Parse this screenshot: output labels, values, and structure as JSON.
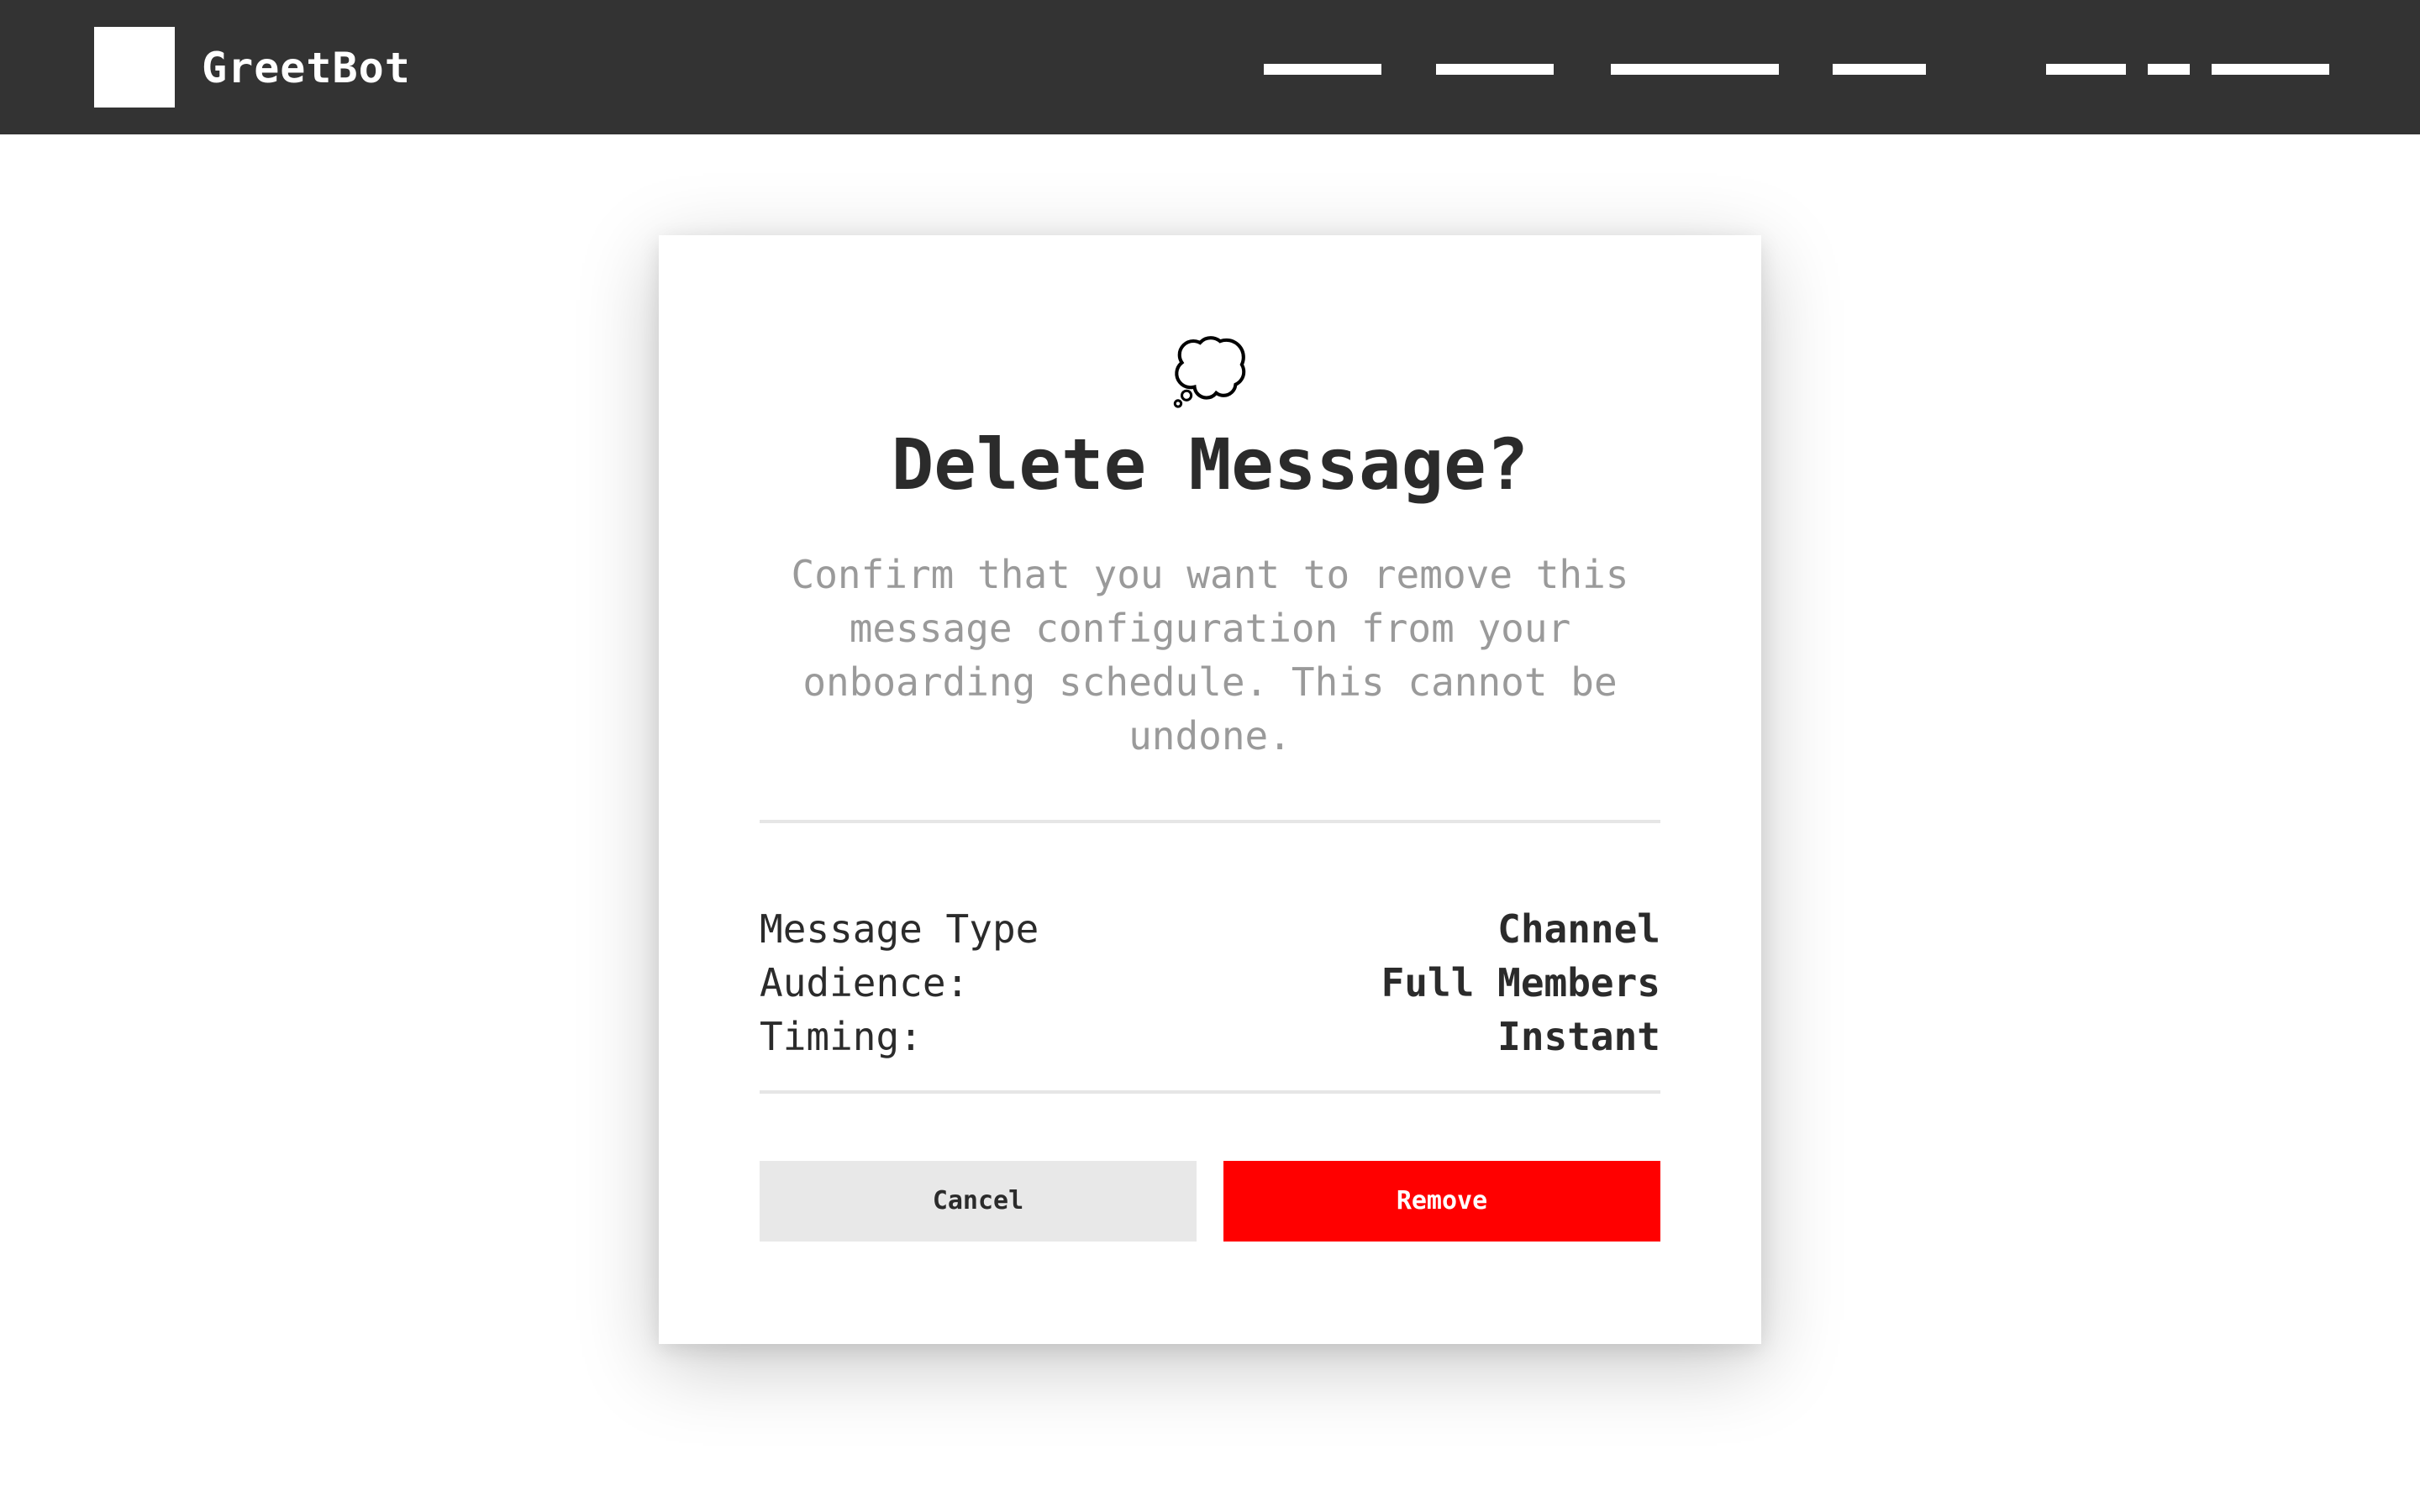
{
  "app": {
    "name": "GreetBot",
    "logo_icon": "square-logo-icon"
  },
  "colors": {
    "header_bg": "#333333",
    "danger": "#ff0000",
    "cancel_bg": "#e8e8e8",
    "text_primary": "#2b2b2b",
    "text_muted": "#9a9a9a"
  },
  "dialog": {
    "icon": "thought-bubble-icon",
    "icon_glyph": "💭",
    "title": "Delete Message?",
    "description": "Confirm that you want to remove this message configuration from your onboarding schedule. This cannot be undone.",
    "details": [
      {
        "label": "Message Type",
        "value": "Channel"
      },
      {
        "label": "Audience:",
        "value": "Full Members"
      },
      {
        "label": "Timing:",
        "value": "Instant"
      }
    ],
    "cancel_label": "Cancel",
    "confirm_label": "Remove"
  }
}
